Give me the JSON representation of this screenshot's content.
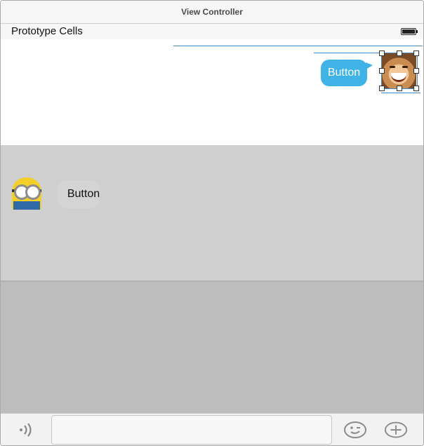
{
  "window": {
    "title": "View Controller"
  },
  "header": {
    "section_title": "Prototype Cells",
    "battery_icon": "battery-icon"
  },
  "cells": {
    "outgoing": {
      "button_label": "Button",
      "avatar": "avatar-photo"
    },
    "incoming": {
      "button_label": "Button",
      "avatar": "minion-avatar"
    }
  },
  "toolbar": {
    "voice_icon": "voice-icon",
    "input_value": "",
    "emoji_icon": "emoji-icon",
    "add_icon": "add-icon"
  },
  "colors": {
    "accent_blue": "#3fb2e6",
    "selection_blue": "#3e86c5",
    "incoming_cell": "#cfcfcf",
    "lower_area": "#bdbdbd"
  }
}
